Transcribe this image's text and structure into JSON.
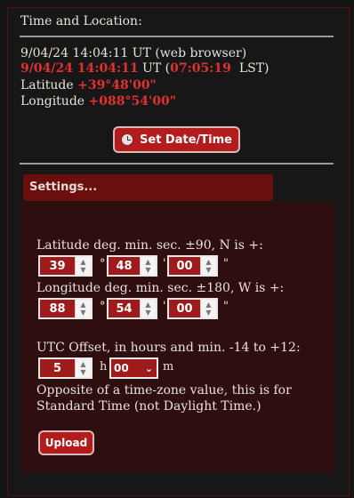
{
  "header": {
    "title": "Time and Location:"
  },
  "time": {
    "browser_time": "9/04/24 14:04:11",
    "browser_suffix": "UT (web browser)",
    "ut_time": "9/04/24 14:04:11",
    "ut_label": "UT (",
    "lst_time": "07:05:19",
    "lst_suffix": "LST)",
    "latitude_label": "Latitude",
    "latitude_value": "+39°48'00\"",
    "longitude_label": "Longitude",
    "longitude_value": "+088°54'00\""
  },
  "buttons": {
    "set_datetime": "Set Date/Time",
    "upload": "Upload"
  },
  "settings": {
    "header": "Settings...",
    "lat_label": "Latitude deg. min. sec. ±90, N is +:",
    "lat": {
      "deg": "39",
      "min": "48",
      "sec": "00"
    },
    "lon_label": "Longitude deg. min. sec. ±180, W is +:",
    "lon": {
      "deg": "88",
      "min": "54",
      "sec": "00"
    },
    "symbols": {
      "deg": "°",
      "min": "'",
      "sec": "\""
    },
    "utc_label": "UTC Offset, in hours and min. -14 to +12:",
    "utc_hours": "5",
    "utc_h_unit": "h",
    "utc_minutes": "00",
    "utc_m_unit": "m",
    "note_line1": "Opposite of a time-zone value, this is for",
    "note_line2": "Standard Time (not Daylight Time.)"
  },
  "colors": {
    "accent": "#e23030",
    "button": "#b21c1c",
    "panel": "#2e0e0e",
    "header": "#6b0e0e"
  }
}
